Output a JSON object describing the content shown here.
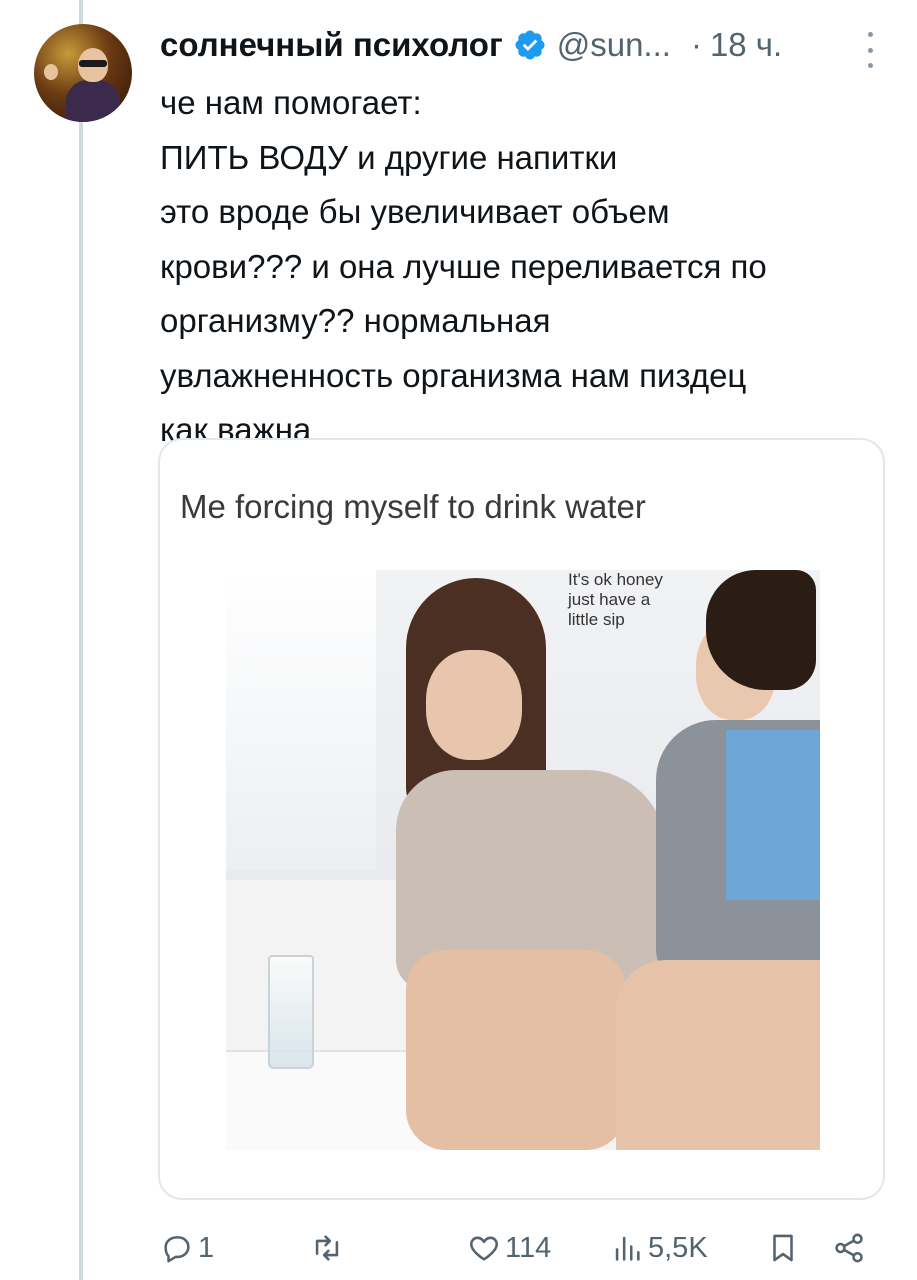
{
  "author": {
    "display_name": "солнечный психолог",
    "handle": "@sun...",
    "separator": "·",
    "time": "18 ч.",
    "verified": true
  },
  "tweet": {
    "lines": [
      "че нам помогает:",
      "ПИТЬ ВОДУ и другие напитки",
      "это вроде бы увеличивает объем",
      "крови??? и она лучше переливается по",
      "организму?? нормальная",
      "увлажненность организма нам пиздец",
      "как важна"
    ]
  },
  "media": {
    "caption": "Me forcing myself to drink water",
    "speech_lines": [
      "It's ok honey",
      "just have a",
      "little sip"
    ]
  },
  "actions": {
    "replies": "1",
    "retweets": "",
    "likes": "114",
    "views": "5,5K"
  },
  "icons": {
    "verified": "verified-badge-icon",
    "reply": "comment-icon",
    "retweet": "retweet-icon",
    "like": "heart-icon",
    "views": "bar-chart-icon",
    "bookmark": "bookmark-icon",
    "share": "share-icon",
    "more": "more-vertical-icon"
  },
  "colors": {
    "verified": "#1d9bf0",
    "muted": "#536471",
    "text": "#0f1419",
    "thread_line": "#cfd9de"
  }
}
